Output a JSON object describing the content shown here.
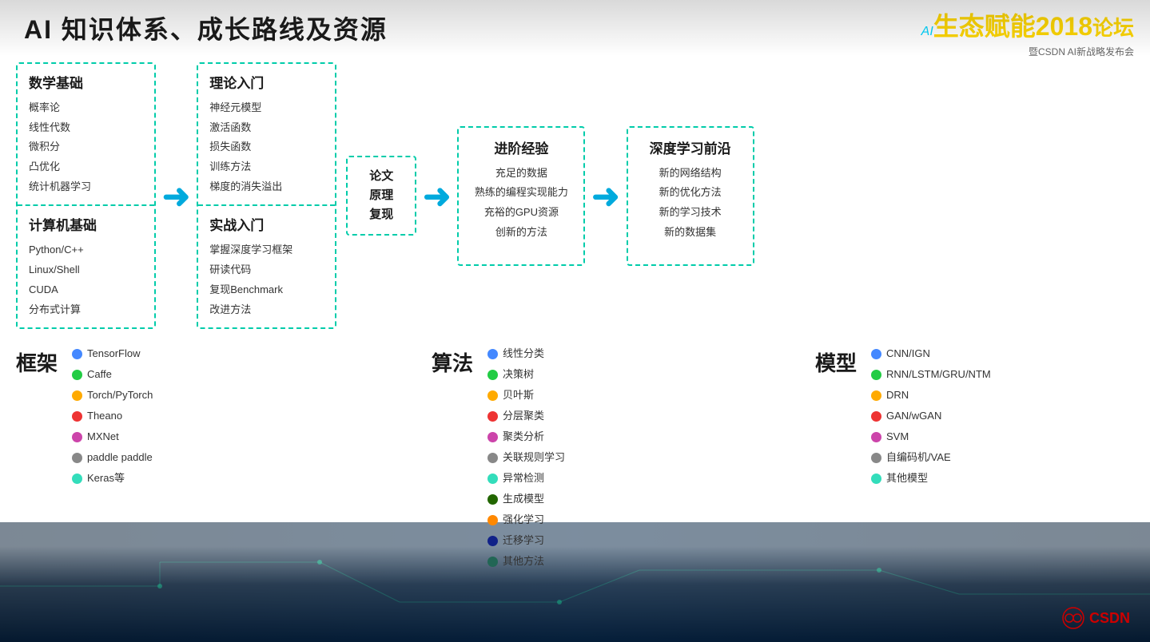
{
  "header": {
    "title": "AI 知识体系、成长路线及资源"
  },
  "logo": {
    "line1_ai": "AI",
    "line1_eco": "生态赋能",
    "line1_year": "2018",
    "line1_forum": "论坛",
    "line2": "暨CSDN AI新战略发布会"
  },
  "flow": {
    "math_title": "数学基础",
    "math_items": [
      "概率论",
      "线性代数",
      "微积分",
      "凸优化",
      "统计机器学习"
    ],
    "cs_title": "计算机基础",
    "cs_items": [
      "Python/C++",
      "Linux/Shell",
      "CUDA",
      "分布式计算"
    ],
    "theory_title": "理论入门",
    "theory_items": [
      "神经元模型",
      "激活函数",
      "损失函数",
      "训练方法",
      "梯度的消失溢出"
    ],
    "practice_title": "实战入门",
    "practice_items": [
      "掌握深度学习框架",
      "研读代码",
      "复现Benchmark",
      "改进方法"
    ],
    "paper_title": "论文\n原理\n复现",
    "advanced_title": "进阶经验",
    "advanced_items": [
      "充足的数据",
      "熟练的编程实现能力",
      "充裕的GPU资源",
      "创新的方法"
    ],
    "deep_title": "深度学习前沿",
    "deep_items": [
      "新的网络结构",
      "新的优化方法",
      "新的学习技术",
      "新的数据集"
    ]
  },
  "frameworks": {
    "label": "框架",
    "items": [
      {
        "name": "TensorFlow",
        "color": "#4488ff"
      },
      {
        "name": "Caffe",
        "color": "#22cc44"
      },
      {
        "name": "Torch/PyTorch",
        "color": "#ffaa00"
      },
      {
        "name": "Theano",
        "color": "#ee3333"
      },
      {
        "name": "MXNet",
        "color": "#cc44aa"
      },
      {
        "name": "paddle paddle",
        "color": "#888888"
      },
      {
        "name": "Keras等",
        "color": "#33ddbb"
      }
    ]
  },
  "algorithms": {
    "label": "算法",
    "items": [
      {
        "name": "线性分类",
        "color": "#4488ff"
      },
      {
        "name": "决策树",
        "color": "#22cc44"
      },
      {
        "name": "贝叶斯",
        "color": "#ffaa00"
      },
      {
        "name": "分层聚类",
        "color": "#ee3333"
      },
      {
        "name": "聚类分析",
        "color": "#cc44aa"
      },
      {
        "name": "关联规则学习",
        "color": "#888888"
      },
      {
        "name": "异常检测",
        "color": "#33ddbb"
      },
      {
        "name": "生成模型",
        "color": "#226600"
      },
      {
        "name": "强化学习",
        "color": "#ff8800"
      },
      {
        "name": "迁移学习",
        "color": "#112288"
      },
      {
        "name": "其他方法",
        "color": "#226655"
      }
    ]
  },
  "models": {
    "label": "模型",
    "items": [
      {
        "name": "CNN/IGN",
        "color": "#4488ff"
      },
      {
        "name": "RNN/LSTM/GRU/NTM",
        "color": "#22cc44"
      },
      {
        "name": "DRN",
        "color": "#ffaa00"
      },
      {
        "name": "GAN/wGAN",
        "color": "#ee3333"
      },
      {
        "name": "SVM",
        "color": "#cc44aa"
      },
      {
        "name": "自编码机/VAE",
        "color": "#888888"
      },
      {
        "name": "其他模型",
        "color": "#33ddbb"
      }
    ]
  }
}
